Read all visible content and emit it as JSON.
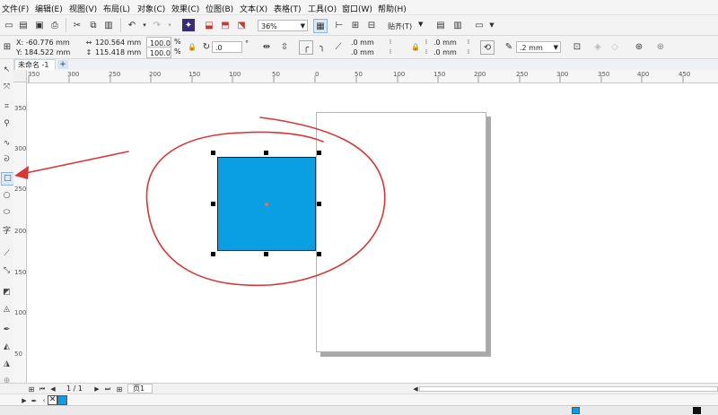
{
  "menu": {
    "file": "文件(F)",
    "edit": "编辑(E)",
    "view": "视图(V)",
    "layout": "布局(L)",
    "object": "对象(C)",
    "effects": "效果(C)",
    "bitmaps": "位图(B)",
    "text": "文本(X)",
    "table": "表格(T)",
    "tools": "工具(O)",
    "window": "窗口(W)",
    "help": "帮助(H)"
  },
  "toolbar": {
    "zoom_value": "36%",
    "snap_label": "贴齐(T)"
  },
  "property_bar": {
    "x_value": "X: -60.776 mm",
    "y_value": "Y: 184.522 mm",
    "width_value": "120.564 mm",
    "height_value": "115.418 mm",
    "scale_x": "100.0",
    "scale_y": "100.0",
    "percent": "%",
    "rotation_value": ".0",
    "degree": "°",
    "corner_1": ".0 mm",
    "corner_2": ".0 mm",
    "corner_3": ".0 mm",
    "corner_4": ".0 mm",
    "outline_width": ".2 mm"
  },
  "document_tab": "未命名 -1",
  "ruler_h_ticks": [
    "350",
    "300",
    "250",
    "200",
    "150",
    "100",
    "50",
    "0",
    "50",
    "100",
    "150",
    "200",
    "250",
    "300",
    "350",
    "400",
    "450"
  ],
  "ruler_v_ticks": [
    "350",
    "300",
    "250",
    "200",
    "150",
    "100",
    "50"
  ],
  "page_nav": {
    "counter": "1 / 1",
    "page_tab": "页1"
  },
  "colors": {
    "rect_fill": "#0a9ee2",
    "annotation": "#d93636",
    "accent": "#1f7fd0"
  }
}
